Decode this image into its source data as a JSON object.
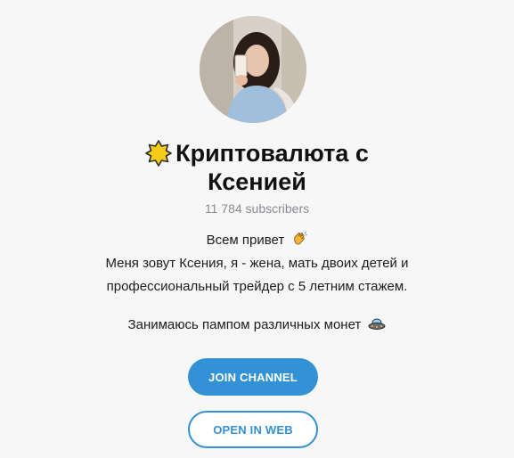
{
  "channel": {
    "title_line1": "Криптовалюта с",
    "title_line2": "Ксенией",
    "subscribers": "11 784 subscribers",
    "title_icon": "star-badge-icon",
    "description": {
      "line1": "Всем привет",
      "line1_emoji": "waving-hand-icon",
      "line2": "Меня зовут Ксения, я - жена, мать двоих детей и",
      "line3": "профессиональный трейдер с 5 летним стажем.",
      "line4": "Занимаюсь пампом различных монет",
      "line4_emoji": "ufo-icon"
    }
  },
  "buttons": {
    "join_label": "JOIN CHANNEL",
    "web_label": "OPEN IN WEB"
  },
  "colors": {
    "accent": "#3391d6",
    "background": "#f7f7f8",
    "star": "#f5cc1a"
  }
}
